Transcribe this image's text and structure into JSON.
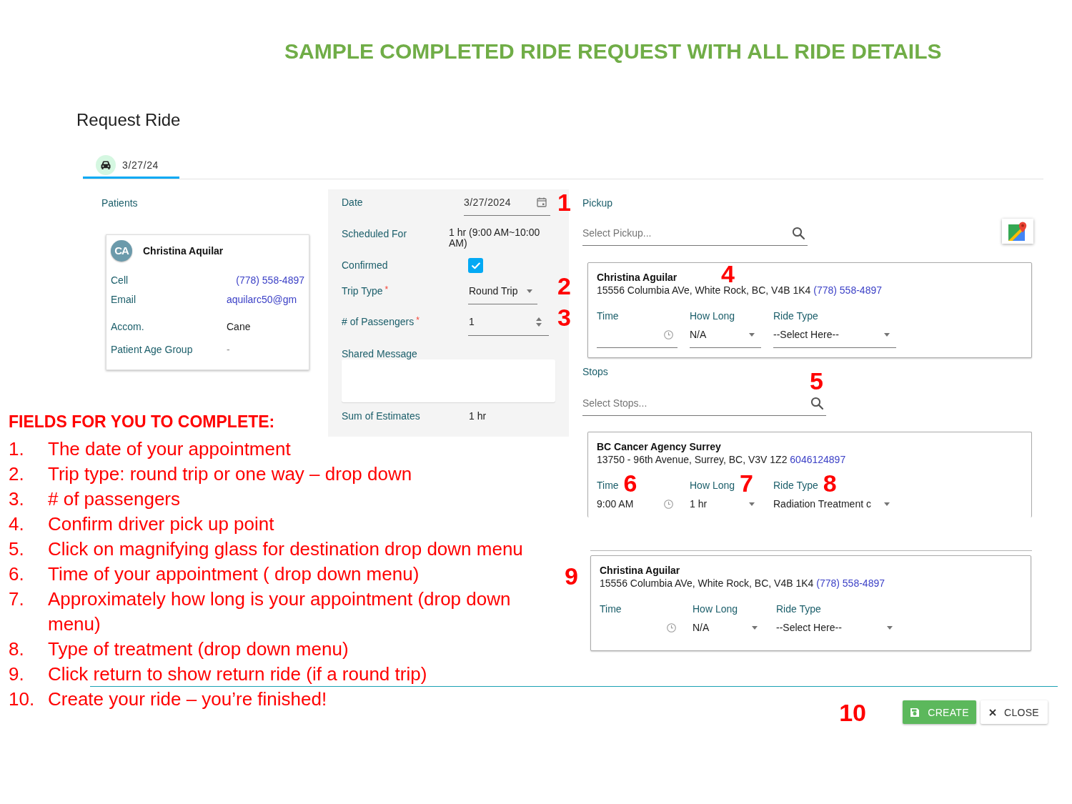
{
  "title": "SAMPLE COMPLETED RIDE REQUEST WITH ALL RIDE DETAILS",
  "heading": "Request Ride",
  "tabs": [
    {
      "label": "3/27/24",
      "selected": true
    }
  ],
  "patients": {
    "label": "Patients",
    "cards": [
      {
        "initials": "CA",
        "name": "Christina Aquilar",
        "fields": [
          {
            "kind": "phone",
            "label": "Cell",
            "value": "(778) 558-4897"
          },
          {
            "kind": "email",
            "label": "Email",
            "value": "aquilarc50@gm"
          },
          {
            "kind": "text",
            "label": "Accom.",
            "value": "Cane"
          },
          {
            "kind": "empty",
            "label": "Patient Age Group",
            "value": "-"
          }
        ]
      }
    ]
  },
  "details": {
    "rows": [
      {
        "kind": "date",
        "label": "Date",
        "value": "3/27/2024",
        "callout": "1"
      },
      {
        "kind": "schedule",
        "label": "Scheduled For",
        "value": "1 hr (9:00 AM~10:00 AM)"
      },
      {
        "kind": "checkbox",
        "label": "Confirmed",
        "checked": true
      },
      {
        "kind": "select",
        "label": "Trip Type",
        "required_mark": "*",
        "value": "Round Trip",
        "callout": "2"
      },
      {
        "kind": "number",
        "label": "# of Passengers",
        "required_mark": "*",
        "value": "1",
        "callout": "3"
      },
      {
        "kind": "textarea",
        "label": "Shared Message"
      },
      {
        "kind": "text",
        "label": "Sum of Estimates",
        "value": "1 hr"
      }
    ]
  },
  "pickup": {
    "label": "Pickup",
    "search": {
      "placeholder": "Select Pickup..."
    },
    "card": {
      "name": "Christina Aguilar",
      "address": "15556 Columbia AVe, White Rock, BC, V4B 1K4",
      "phone": "(778) 558-4897",
      "callout": "4",
      "underlined": true,
      "cropped": false,
      "fields": [
        {
          "kind": "time",
          "label": "Time"
        },
        {
          "kind": "select",
          "label": "How Long",
          "value": "N/A"
        },
        {
          "kind": "select",
          "label": "Ride Type",
          "value": "--Select Here--"
        }
      ]
    }
  },
  "stops": {
    "label": "Stops",
    "search": {
      "placeholder": "Select Stops...",
      "callout": "5"
    },
    "cards": [
      {
        "name": "BC Cancer Agency Surrey",
        "address": "13750 - 96th Avenue, Surrey, BC, V3V 1Z2",
        "phone": "6046124897",
        "underlined": false,
        "cropped": true,
        "fields": [
          {
            "kind": "time",
            "label": "Time",
            "value": "9:00 AM",
            "callout": "6"
          },
          {
            "kind": "select",
            "label": "How Long",
            "value": "1 hr",
            "callout": "7"
          },
          {
            "kind": "select",
            "label": "Ride Type",
            "value": "Radiation Treatment c",
            "callout": "8"
          }
        ]
      }
    ]
  },
  "return_trip": {
    "callout": "9",
    "card": {
      "name": "Christina Aguilar",
      "address": "15556 Columbia AVe, White Rock, BC, V4B 1K4",
      "phone": "(778) 558-4897",
      "underlined": false,
      "cropped": false,
      "fields": [
        {
          "kind": "time",
          "label": "Time"
        },
        {
          "kind": "select",
          "label": "How Long",
          "value": "N/A"
        },
        {
          "kind": "select",
          "label": "Ride Type",
          "value": "--Select Here--"
        }
      ]
    }
  },
  "instructions": {
    "heading": "FIELDS FOR YOU TO COMPLETE:",
    "items": [
      {
        "number": "1.",
        "text": "The date of your appointment"
      },
      {
        "number": "2.",
        "text": "Trip type: round trip or one way – drop down"
      },
      {
        "number": "3.",
        "text": "# of passengers"
      },
      {
        "number": "4.",
        "text": "Confirm driver pick up point"
      },
      {
        "number": "5.",
        "text": "Click on magnifying glass for destination drop down menu"
      },
      {
        "number": "6.",
        "text": "Time of your appointment ( drop down menu)"
      },
      {
        "number": "7.",
        "text": "Approximately how long is your appointment (drop down menu)"
      },
      {
        "number": "8.",
        "text": "Type of treatment (drop down menu)"
      },
      {
        "number": "9.",
        "text": "Click return to show return ride (if a round trip)"
      },
      {
        "number": "10.",
        "text": "Create your ride – you’re finished!"
      }
    ]
  },
  "footer": {
    "callout": "10",
    "buttons": [
      {
        "kind": "create",
        "label": "CREATE"
      },
      {
        "kind": "close",
        "label": "CLOSE"
      }
    ]
  }
}
